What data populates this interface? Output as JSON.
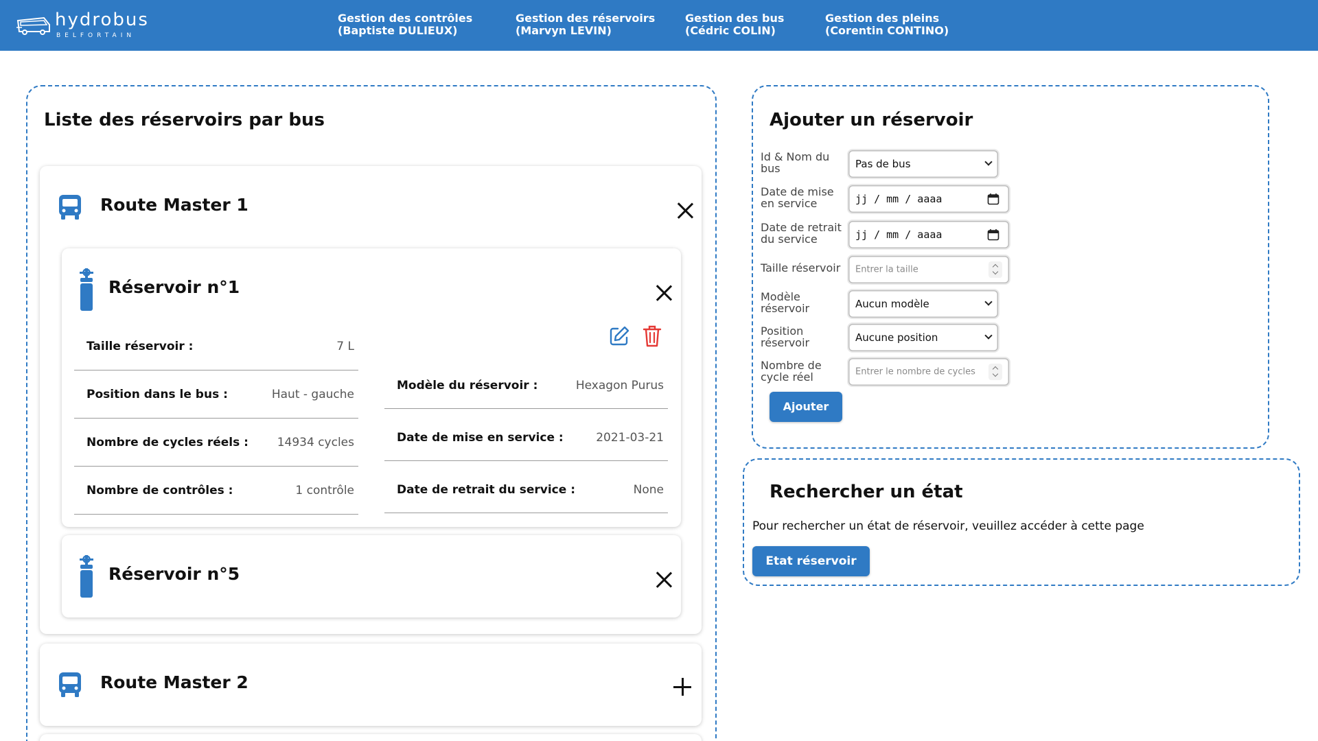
{
  "brand": {
    "name": "hydrobus",
    "subtitle": "BELFORTAIN"
  },
  "nav": [
    {
      "line1": "Gestion des contrôles",
      "line2": "(Baptiste DULIEUX)"
    },
    {
      "line1": "Gestion des réservoirs",
      "line2": "(Marvyn LEVIN)"
    },
    {
      "line1": "Gestion des bus",
      "line2": "(Cédric COLIN)"
    },
    {
      "line1": "Gestion des pleins",
      "line2": "(Corentin CONTINO)"
    }
  ],
  "list": {
    "title": "Liste des réservoirs par bus",
    "buses": [
      {
        "name": "Route Master 1",
        "reservoirs": [
          {
            "title": "Réservoir n°1",
            "left_rows": [
              {
                "label": "Taille réservoir :",
                "value": "7 L"
              },
              {
                "label": "Position dans le bus :",
                "value": "Haut - gauche"
              },
              {
                "label": "Nombre de cycles réels :",
                "value": "14934 cycles"
              },
              {
                "label": "Nombre de contrôles :",
                "value": "1 contrôle"
              }
            ],
            "right_rows": [
              {
                "label": "Modèle du réservoir :",
                "value": "Hexagon Purus"
              },
              {
                "label": "Date de mise en service :",
                "value": "2021-03-21"
              },
              {
                "label": "Date de retrait du service :",
                "value": "None"
              }
            ]
          },
          {
            "title": "Réservoir n°5"
          }
        ]
      },
      {
        "name": "Route Master 2"
      }
    ]
  },
  "add_form": {
    "title": "Ajouter un réservoir",
    "fields": [
      {
        "label": "Id & Nom du bus",
        "value": "Pas de bus"
      },
      {
        "label": "Date de mise en service",
        "value": "jj / mm / aaaa"
      },
      {
        "label": "Date de retrait du service",
        "value": "jj / mm / aaaa"
      },
      {
        "label": "Taille réservoir",
        "placeholder": "Entrer la taille"
      },
      {
        "label": "Modèle réservoir",
        "value": "Aucun modèle"
      },
      {
        "label": "Position réservoir",
        "value": "Aucune position"
      },
      {
        "label": "Nombre de cycle réel",
        "placeholder": "Entrer le nombre de cycles"
      }
    ],
    "submit_label": "Ajouter"
  },
  "search": {
    "title": "Rechercher un état",
    "text": "Pour rechercher un état de réservoir, veuillez accéder à cette page",
    "button_label": "Etat réservoir"
  },
  "colors": {
    "primary": "#2f7ac4",
    "delete": "#e53935",
    "edit": "#2f7ac4"
  },
  "icons": [
    "bus-logo-icon",
    "bus-icon",
    "hydrogen-tank-icon",
    "close-icon",
    "plus-icon",
    "edit-icon",
    "trash-icon",
    "calendar-icon",
    "chevron-down-icon",
    "spinner-icon"
  ]
}
